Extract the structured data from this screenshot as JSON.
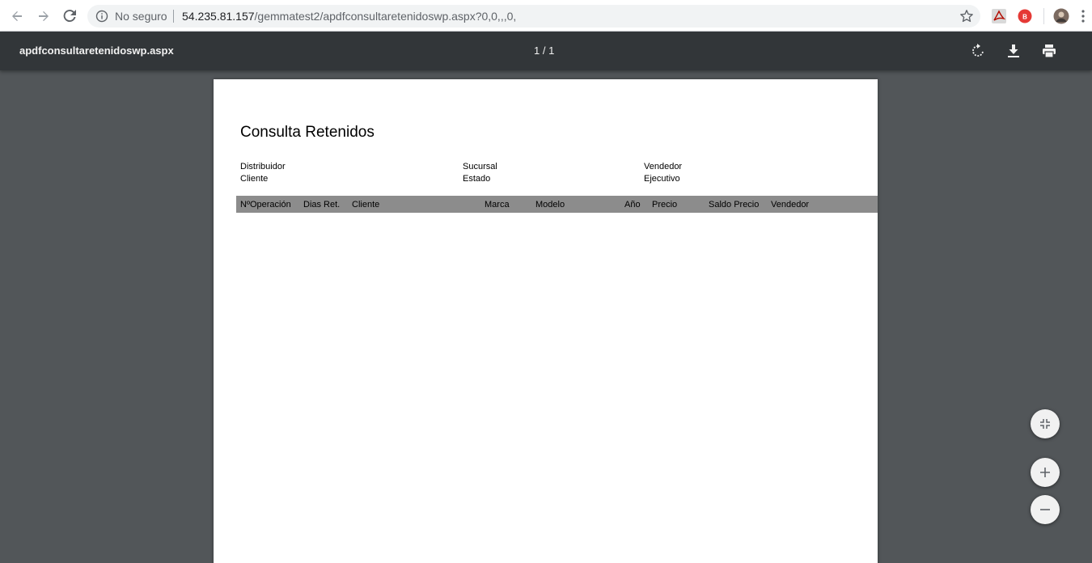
{
  "browser": {
    "security_label": "No seguro",
    "url_host": "54.235.81.157",
    "url_path": "/gemmatest2/apdfconsultaretenidoswp.aspx?0,0,,,0,"
  },
  "pdf_viewer": {
    "file_name": "apdfconsultaretenidoswp.aspx",
    "page_indicator": "1 / 1"
  },
  "document": {
    "title": "Consulta Retenidos",
    "fields": {
      "distribuidor": "Distribuidor",
      "cliente": "Cliente",
      "sucursal": "Sucursal",
      "estado": "Estado",
      "vendedor": "Vendedor",
      "ejecutivo": "Ejecutivo"
    },
    "table_headers": [
      "NºOperación",
      "Dias Ret.",
      "Cliente",
      "Marca",
      "Modelo",
      "Año",
      "Precio",
      "Saldo Precio",
      "Vendedor"
    ]
  },
  "colors": {
    "toolbar_bg": "#323639",
    "viewer_bg": "#525659",
    "table_header_bg": "#8c8c8c"
  }
}
